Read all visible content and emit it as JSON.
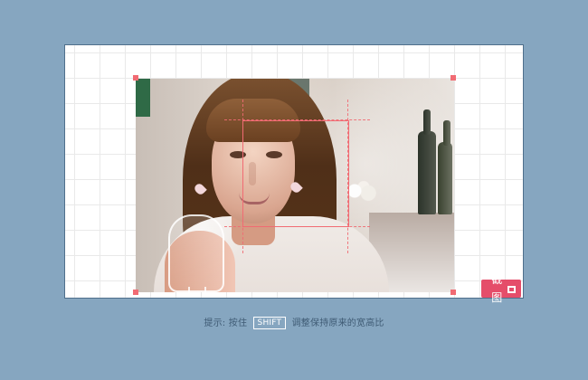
{
  "button": {
    "label": "截图"
  },
  "hint": {
    "prefix": "提示: 按住",
    "key": "SHIFT",
    "suffix": "调整保持原来的宽高比"
  },
  "icons": {
    "crop": "crop-icon"
  },
  "colors": {
    "background": "#86a6c0",
    "grid": "#e9e9e9",
    "accent": "#f16b73",
    "button": "#e54d6a"
  }
}
